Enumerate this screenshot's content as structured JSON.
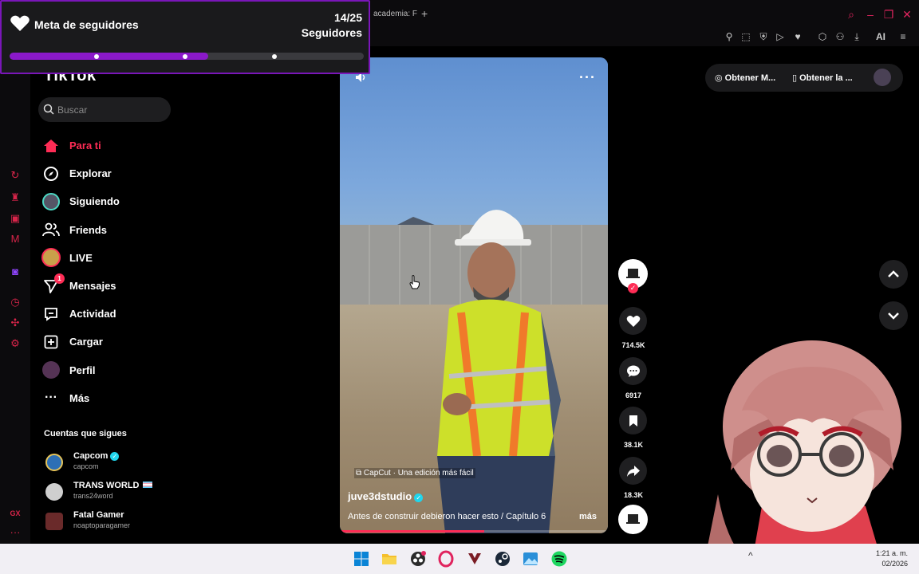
{
  "browser": {
    "tab_title": "academia: F",
    "tab_plus": "+",
    "toolbar_ai": "AI"
  },
  "goal": {
    "title": "Meta de seguidores",
    "count": "14/25",
    "label": "Seguidores",
    "progress": 0.56
  },
  "tiktok": {
    "logo": "TikTok",
    "search_placeholder": "Buscar",
    "nav": [
      {
        "label": "Para ti",
        "icon": "home-icon",
        "active": true
      },
      {
        "label": "Explorar",
        "icon": "compass-icon"
      },
      {
        "label": "Siguiendo",
        "icon": "following-avatar-icon"
      },
      {
        "label": "Friends",
        "icon": "friends-icon"
      },
      {
        "label": "LIVE",
        "icon": "live-avatar-icon"
      },
      {
        "label": "Mensajes",
        "icon": "messages-icon",
        "badge": "1"
      },
      {
        "label": "Actividad",
        "icon": "activity-icon"
      },
      {
        "label": "Cargar",
        "icon": "upload-icon"
      },
      {
        "label": "Perfil",
        "icon": "profile-avatar-icon"
      },
      {
        "label": "Más",
        "icon": "more-dots-icon"
      }
    ],
    "follows_heading": "Cuentas que sigues",
    "follows": [
      {
        "name": "Capcom",
        "handle": "capcom",
        "verified": true,
        "color": "#2d6fb5"
      },
      {
        "name": "TRANS WORLD",
        "handle": "trans24word",
        "flag": true,
        "color": "#cfcfcf"
      },
      {
        "name": "Fatal Gamer",
        "handle": "noaptoparagamer",
        "color": "#6a2a2a"
      }
    ]
  },
  "video": {
    "capcut_label": "CapCut · Una edición más fácil",
    "author": "juve3dstudio",
    "description": "Antes de construir debieron hacer esto / Capítulo 6",
    "more_label": "más",
    "progress": 0.54
  },
  "actions": {
    "likes": "714.5K",
    "comments": "6917",
    "saves": "38.1K",
    "shares": "18.3K"
  },
  "top_right": {
    "get_coins": "Obtener M...",
    "get_app": "Obtener la ..."
  },
  "clock": {
    "time": "1:21 a. m.",
    "date": "02/2026"
  },
  "colors": {
    "tiktok_red": "#fe2c55",
    "goal_purple": "#8a19c9",
    "opera_red": "#d9254a"
  }
}
